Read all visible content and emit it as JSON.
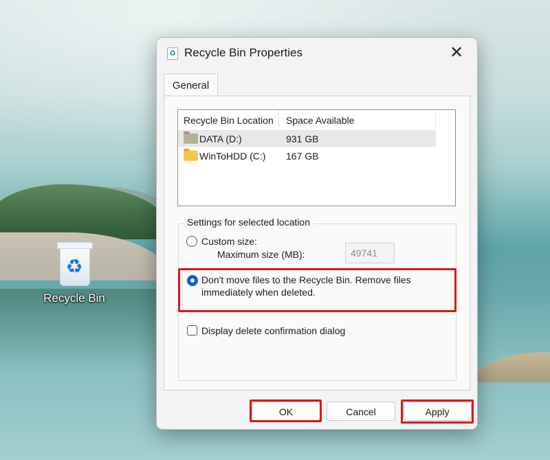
{
  "desktop": {
    "icon_label": "Recycle Bin"
  },
  "dialog": {
    "title": "Recycle Bin Properties",
    "close_glyph": "✕",
    "tab_label": "General",
    "list": {
      "columns": [
        "Recycle Bin Location",
        "Space Available"
      ],
      "rows": [
        {
          "location": "DATA (D:)",
          "space": "931 GB",
          "selected": true
        },
        {
          "location": "WinToHDD (C:)",
          "space": "167 GB",
          "selected": false
        }
      ]
    },
    "settings": {
      "group_title": "Settings for selected location",
      "custom_size_label": "Custom size:",
      "max_size_label": "Maximum size (MB):",
      "max_size_value": "49741",
      "no_recycle_label_line1": "Don't move files to the Recycle Bin. Remove files",
      "no_recycle_label_line2": "immediately when deleted.",
      "selected_option": "no_recycle",
      "confirm_label": "Display delete confirmation dialog",
      "confirm_checked": false
    },
    "buttons": {
      "ok": "OK",
      "cancel": "Cancel",
      "apply": "Apply"
    }
  },
  "colors": {
    "highlight": "#e0151b",
    "accent": "#0f5fcf"
  },
  "icons": {
    "recycle": "recycle-icon",
    "folder": "folder-icon",
    "drive": "drive-icon",
    "close": "close-icon"
  }
}
